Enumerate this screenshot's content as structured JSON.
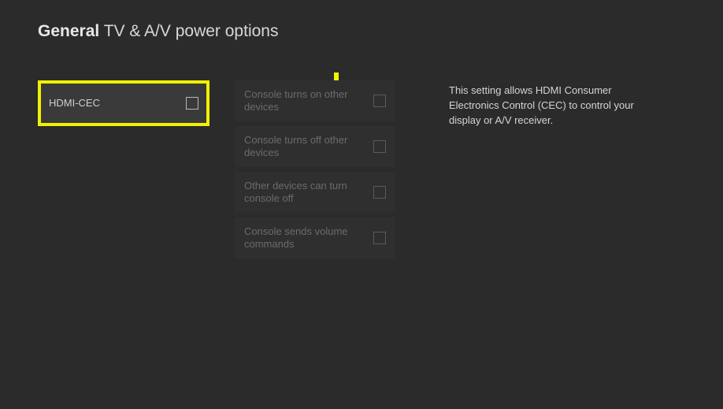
{
  "header": {
    "section": "General",
    "title": "TV & A/V power options"
  },
  "left": {
    "hdmi_cec": "HDMI-CEC"
  },
  "mid": {
    "items": [
      {
        "label": "Console turns on other devices"
      },
      {
        "label": "Console turns off other devices"
      },
      {
        "label": "Other devices can turn console off"
      },
      {
        "label": "Console sends volume commands"
      }
    ]
  },
  "description": "This setting allows HDMI Consumer Electronics Control (CEC) to control your display or A/V receiver."
}
